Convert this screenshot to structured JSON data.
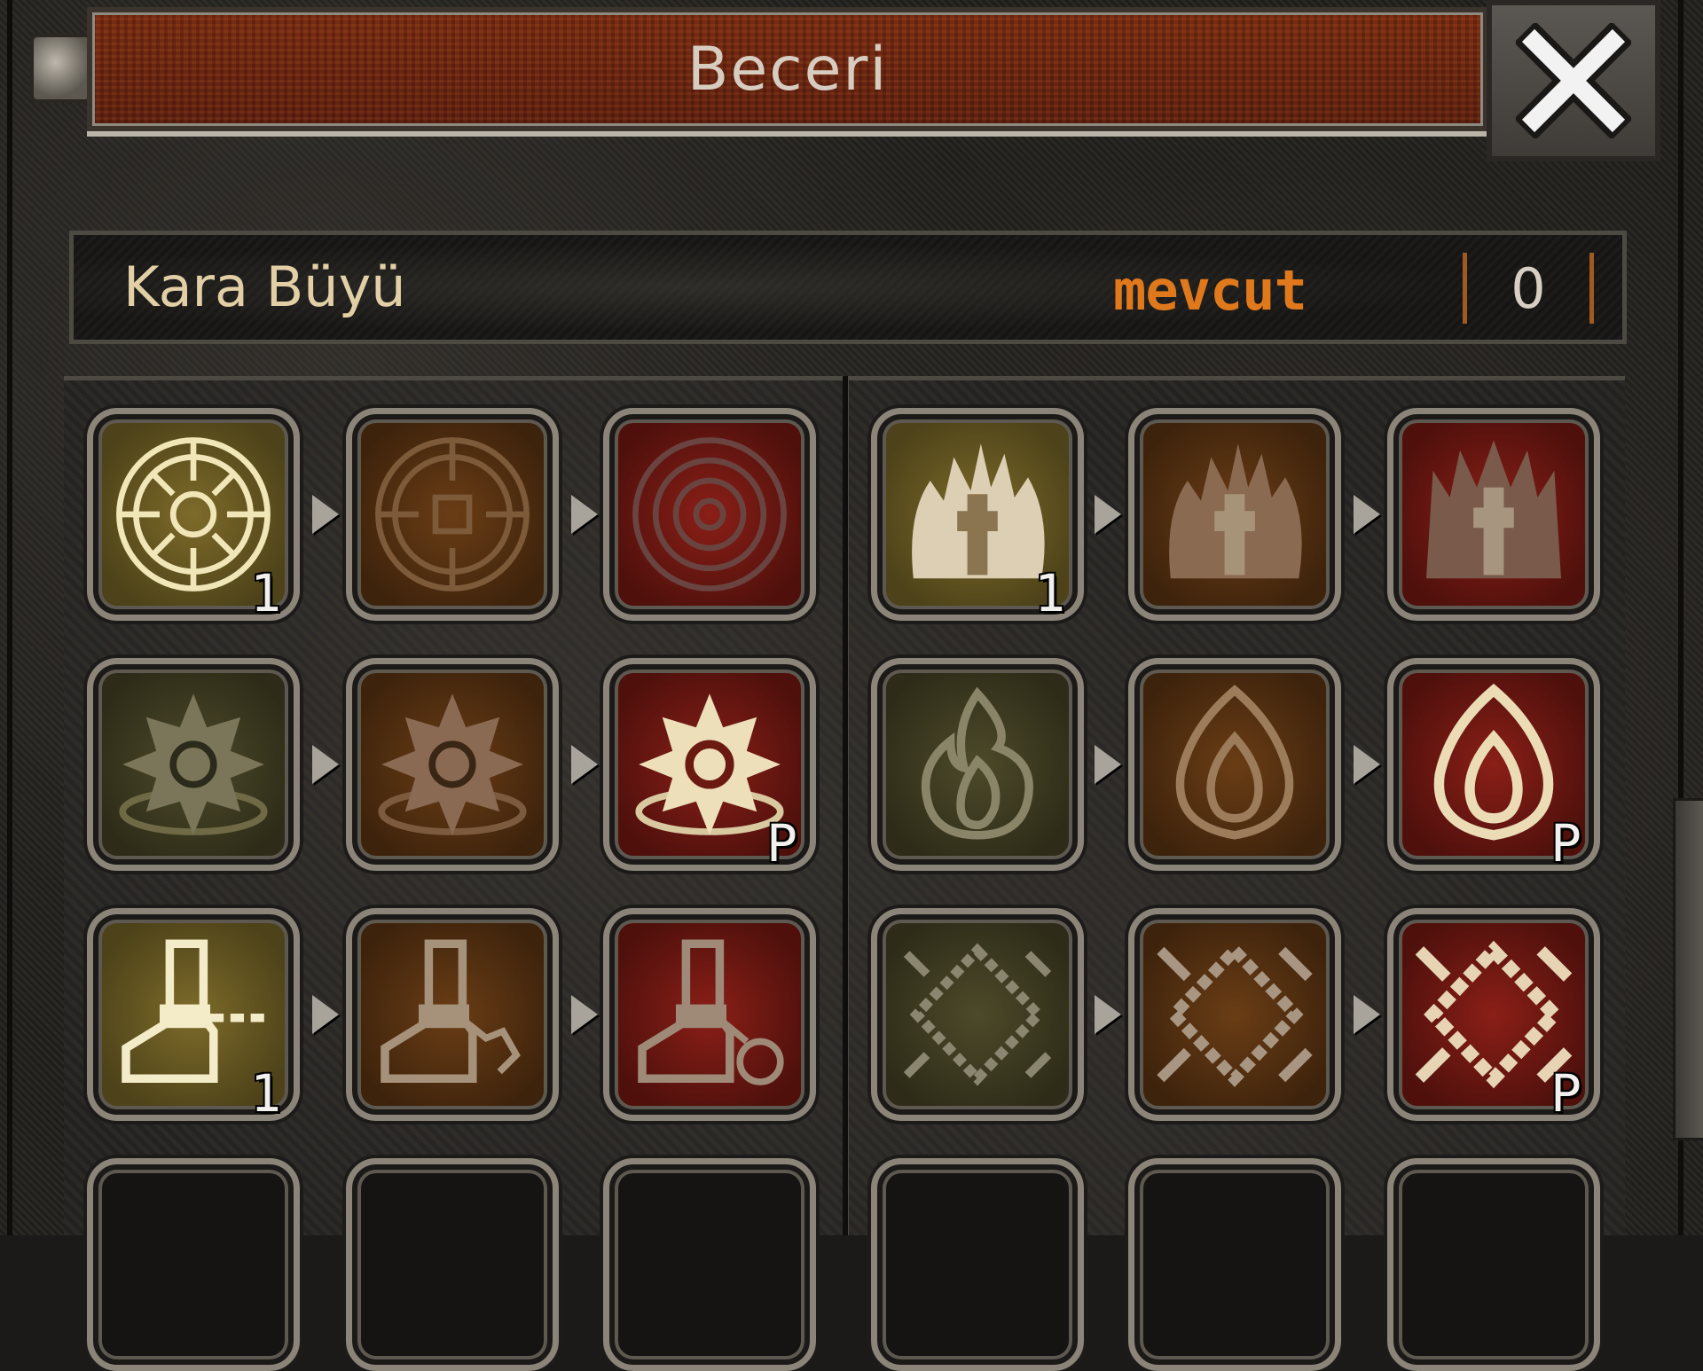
{
  "window": {
    "title": "Beceri"
  },
  "header": {
    "tree_name": "Kara Büyü",
    "available_label": "mevcut",
    "points": "0"
  },
  "skills": [
    {
      "name": "skill-wheel-1",
      "level": "1",
      "tier": "olive"
    },
    {
      "name": "skill-wheel-2",
      "level": "",
      "tier": "brown"
    },
    {
      "name": "skill-wheel-3",
      "level": "",
      "tier": "red"
    },
    {
      "name": "skill-flame-figure-1",
      "level": "1",
      "tier": "olive"
    },
    {
      "name": "skill-flame-figure-2",
      "level": "",
      "tier": "brown"
    },
    {
      "name": "skill-flame-figure-3",
      "level": "",
      "tier": "red"
    },
    {
      "name": "skill-star-1",
      "level": "",
      "tier": "dark"
    },
    {
      "name": "skill-star-2",
      "level": "",
      "tier": "brown"
    },
    {
      "name": "skill-star-3",
      "level": "P",
      "tier": "red"
    },
    {
      "name": "skill-flame-1",
      "level": "",
      "tier": "dark"
    },
    {
      "name": "skill-flame-2",
      "level": "",
      "tier": "brown"
    },
    {
      "name": "skill-flame-3",
      "level": "P",
      "tier": "red"
    },
    {
      "name": "skill-boot-1",
      "level": "1",
      "tier": "olive"
    },
    {
      "name": "skill-boot-2",
      "level": "",
      "tier": "brown"
    },
    {
      "name": "skill-boot-3",
      "level": "",
      "tier": "red"
    },
    {
      "name": "skill-swords-1",
      "level": "",
      "tier": "dark"
    },
    {
      "name": "skill-swords-2",
      "level": "",
      "tier": "brown"
    },
    {
      "name": "skill-swords-3",
      "level": "P",
      "tier": "red"
    }
  ],
  "colors": {
    "title_bar": "#6b2613",
    "accent": "#e0781c",
    "text": "#e2cfa6"
  }
}
